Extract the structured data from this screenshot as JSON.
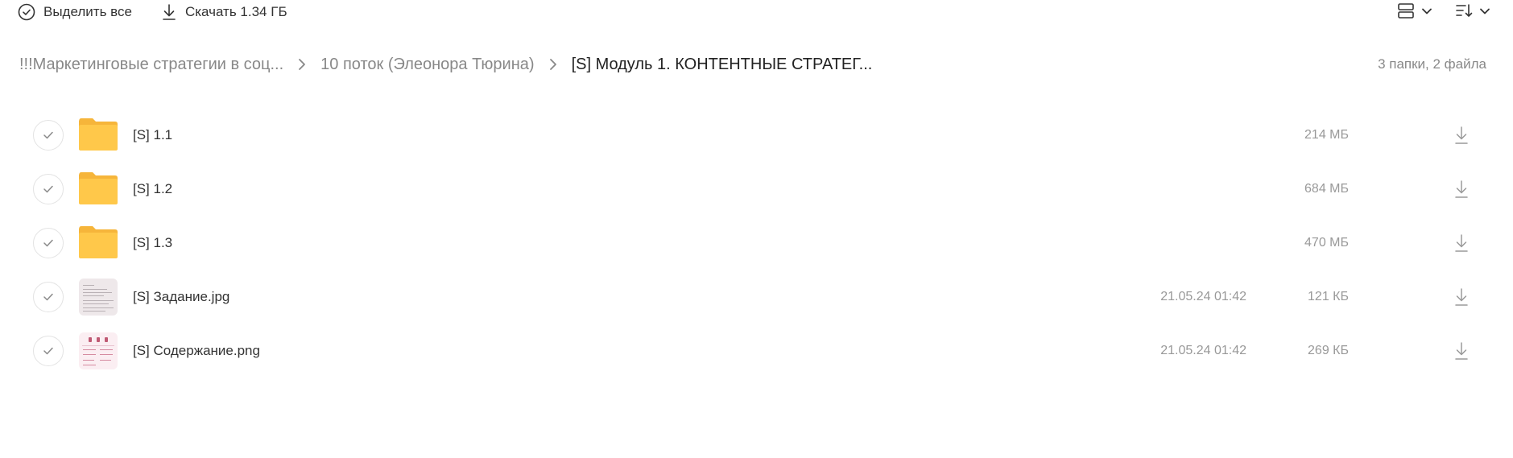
{
  "toolbar": {
    "select_all_label": "Выделить все",
    "download_label": "Скачать 1.34 ГБ",
    "icons": {
      "select_all": "check-circle-icon",
      "download": "download-icon",
      "view": "view-toggle-icon",
      "sort": "sort-icon"
    }
  },
  "breadcrumb": {
    "items": [
      "!!!Маркетинговые стратегии в соц...",
      "10 поток (Элеонора Тюрина)",
      "[S] Модуль 1. КОНТЕНТНЫЕ СТРАТЕГ..."
    ]
  },
  "summary": "3 папки, 2 файла",
  "files": [
    {
      "name": "[S] 1.1",
      "date": "",
      "size": "214 МБ",
      "kind": "folder"
    },
    {
      "name": "[S] 1.2",
      "date": "",
      "size": "684 МБ",
      "kind": "folder"
    },
    {
      "name": "[S] 1.3",
      "date": "",
      "size": "470 МБ",
      "kind": "folder"
    },
    {
      "name": "[S] Задание.jpg",
      "date": "21.05.24 01:42",
      "size": "121 КБ",
      "kind": "image"
    },
    {
      "name": "[S] Содержание.png",
      "date": "21.05.24 01:42",
      "size": "269 КБ",
      "kind": "image"
    }
  ],
  "colors": {
    "folder": "#ffc84a",
    "folder_back": "#f6b53a",
    "text_primary": "#333333",
    "text_muted": "#999999"
  }
}
